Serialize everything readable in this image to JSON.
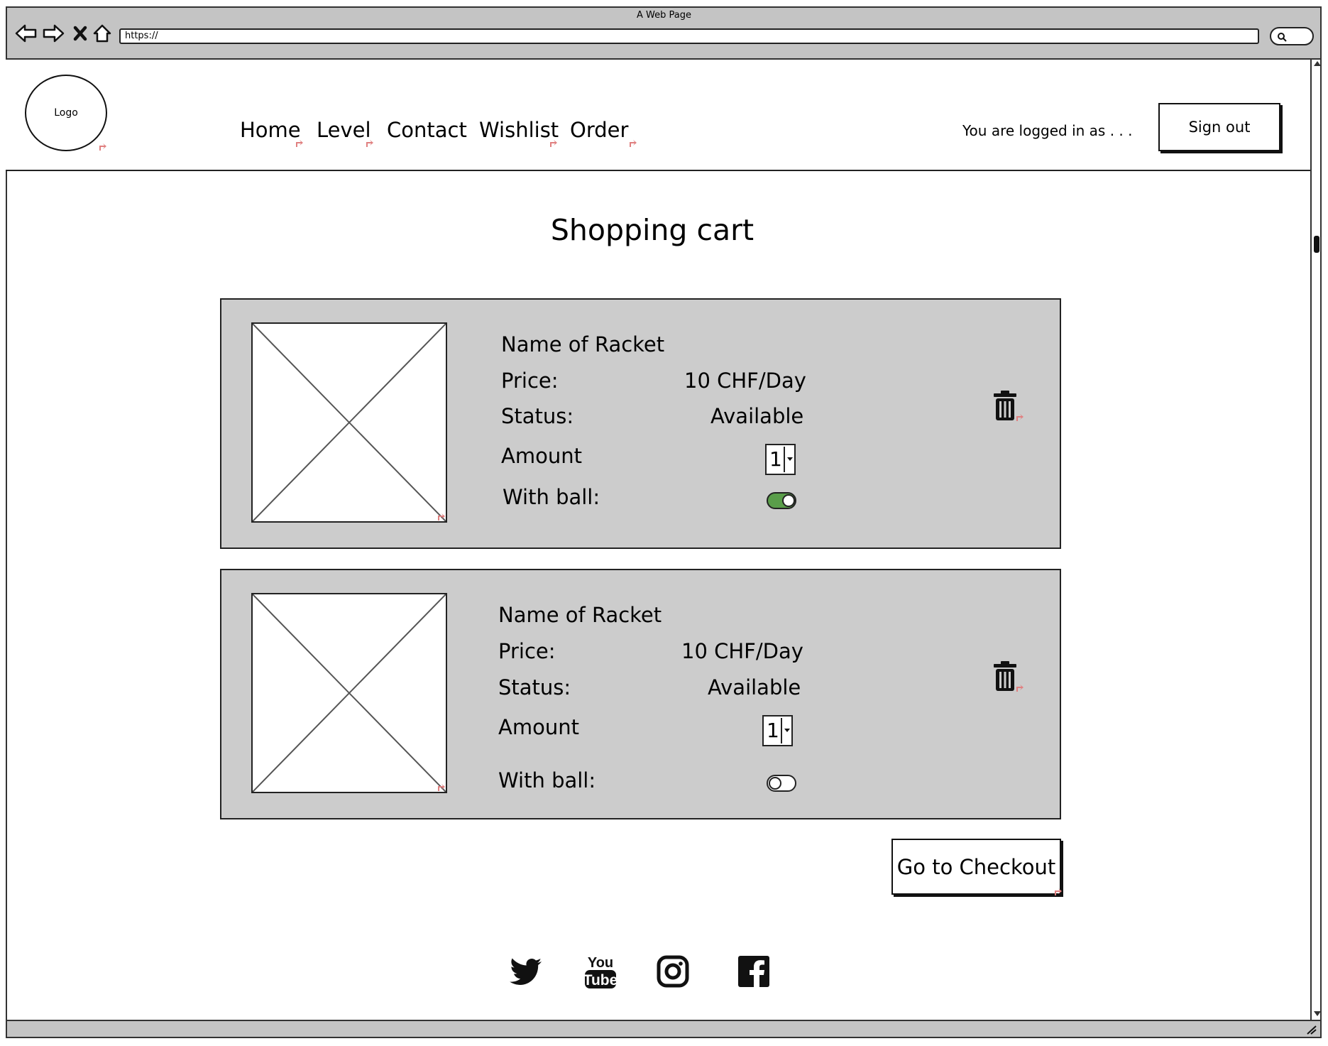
{
  "browser": {
    "title": "A Web Page",
    "url": "https://"
  },
  "header": {
    "logo": "Logo",
    "nav": [
      "Home",
      "Level",
      "Contact",
      "Wishlist",
      "Order"
    ],
    "login_status": "You are logged in as . . .",
    "sign_out": "Sign out"
  },
  "main": {
    "title": "Shopping cart",
    "items": [
      {
        "name": "Name of Racket",
        "price_label": "Price:",
        "price": "10 CHF/Day",
        "status_label": "Status:",
        "status": "Available",
        "amount_label": "Amount",
        "amount": "1",
        "with_ball_label": "With ball:",
        "with_ball": true
      },
      {
        "name": "Name of Racket",
        "price_label": "Price:",
        "price": "10 CHF/Day",
        "status_label": "Status:",
        "status": "Available",
        "amount_label": "Amount",
        "amount": "1",
        "with_ball_label": "With ball:",
        "with_ball": false
      }
    ],
    "checkout": "Go to Checkout"
  },
  "footer": {
    "social": [
      "twitter-icon",
      "youtube-icon",
      "instagram-icon",
      "facebook-icon"
    ]
  },
  "colors": {
    "chrome": "#c4c4c4",
    "card": "#cccccc",
    "toggle_on": "#5a9e4a",
    "link_marker": "#e08080"
  }
}
